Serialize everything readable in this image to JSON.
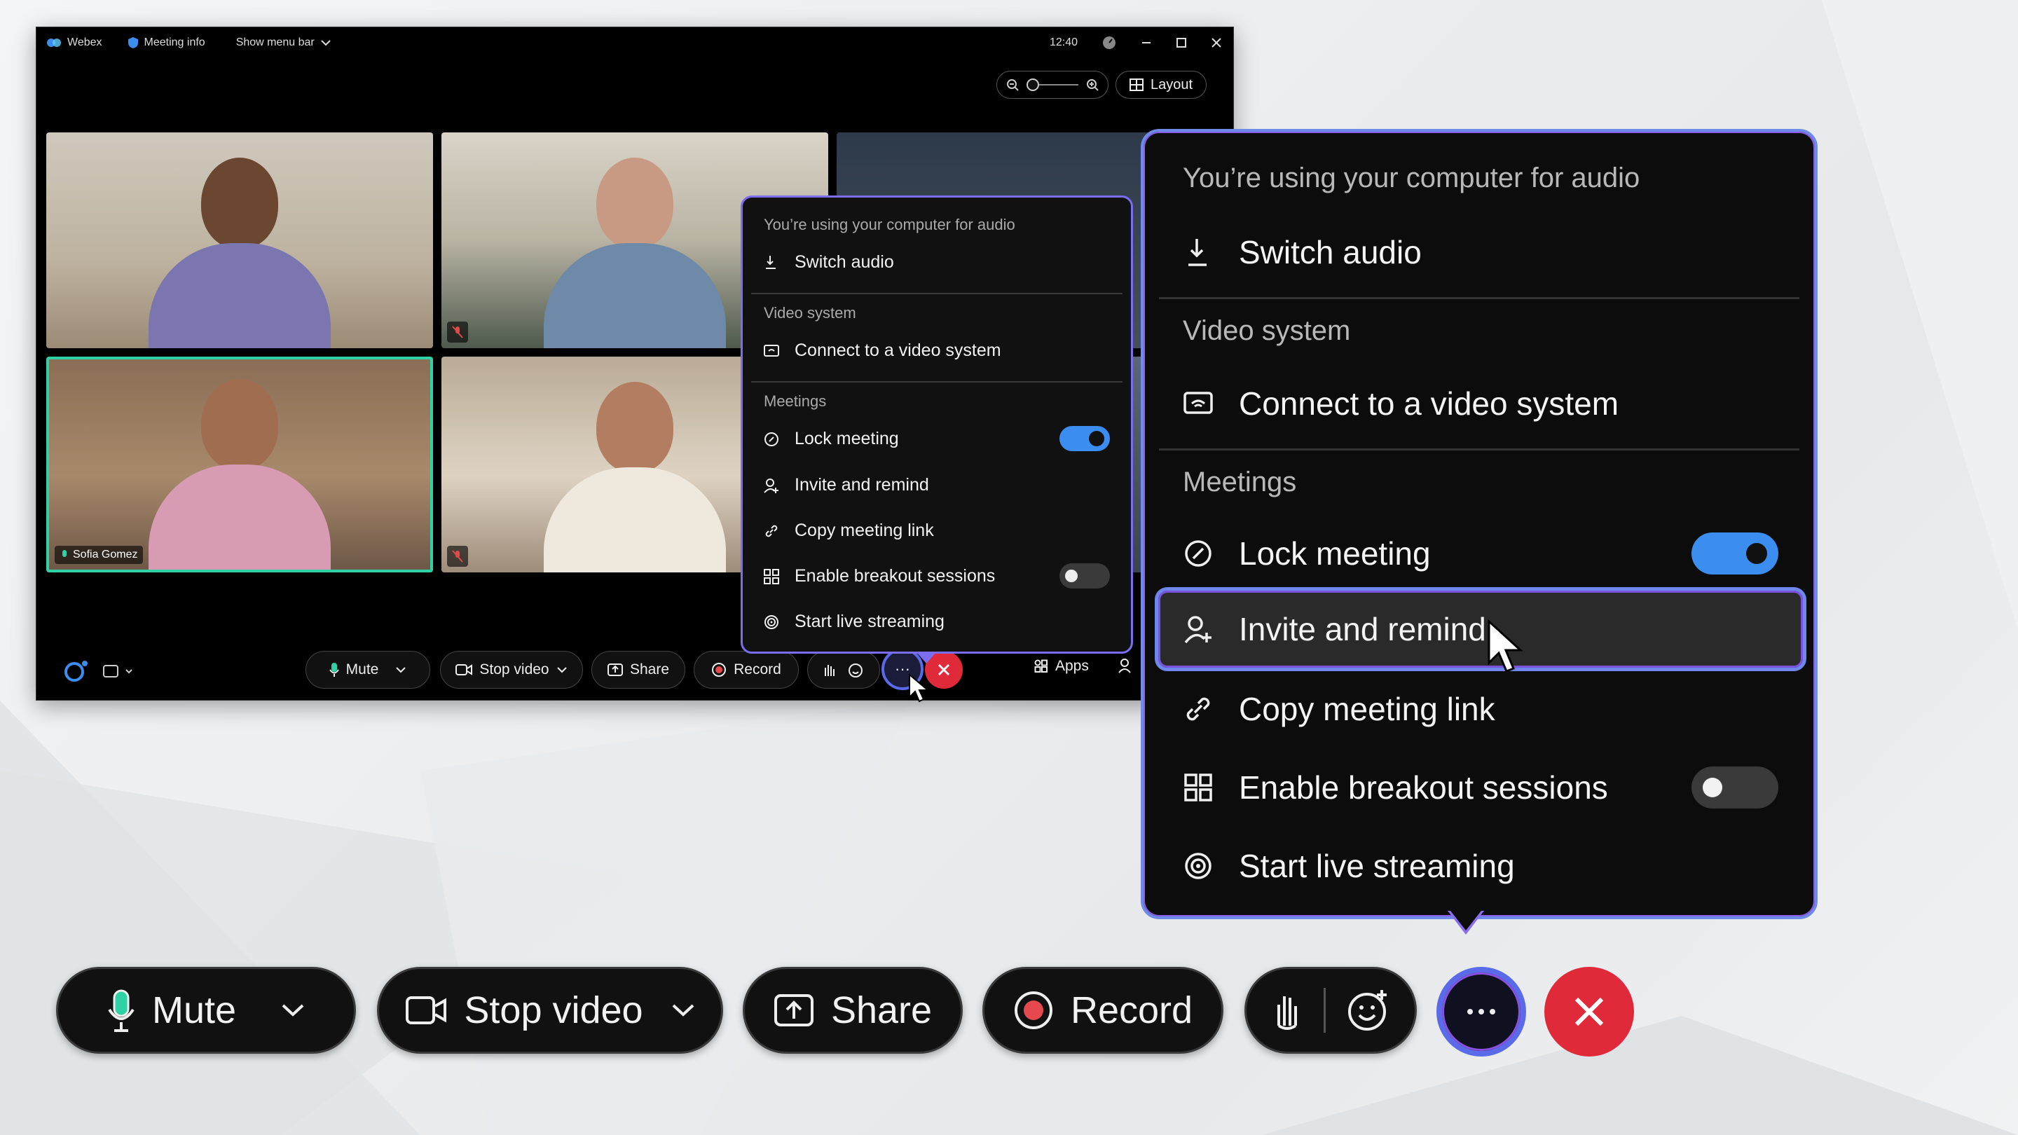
{
  "window": {
    "app_name": "Webex",
    "meeting_info": "Meeting info",
    "show_menu_bar": "Show menu bar",
    "time": "12:40",
    "layout_label": "Layout"
  },
  "participants": {
    "featured_name": "Sofia Gomez"
  },
  "toolbar": {
    "mute": "Mute",
    "stop_video": "Stop video",
    "share": "Share",
    "record": "Record",
    "more": "···",
    "apps": "Apps"
  },
  "menu": {
    "audio_status": "You’re using your computer for audio",
    "switch_audio": "Switch audio",
    "video_system_section": "Video system",
    "connect_video": "Connect to a video system",
    "meetings_section": "Meetings",
    "lock_meeting": "Lock meeting",
    "lock_meeting_on": true,
    "invite": "Invite and remind",
    "copy_link": "Copy meeting link",
    "breakout": "Enable breakout sessions",
    "breakout_on": false,
    "live_streaming": "Start live streaming"
  },
  "colors": {
    "accent_blue": "#3b8ef0",
    "end_red": "#e02a3a",
    "active_speaker": "#2fd1a5",
    "menu_border": "#7b6cf0"
  }
}
